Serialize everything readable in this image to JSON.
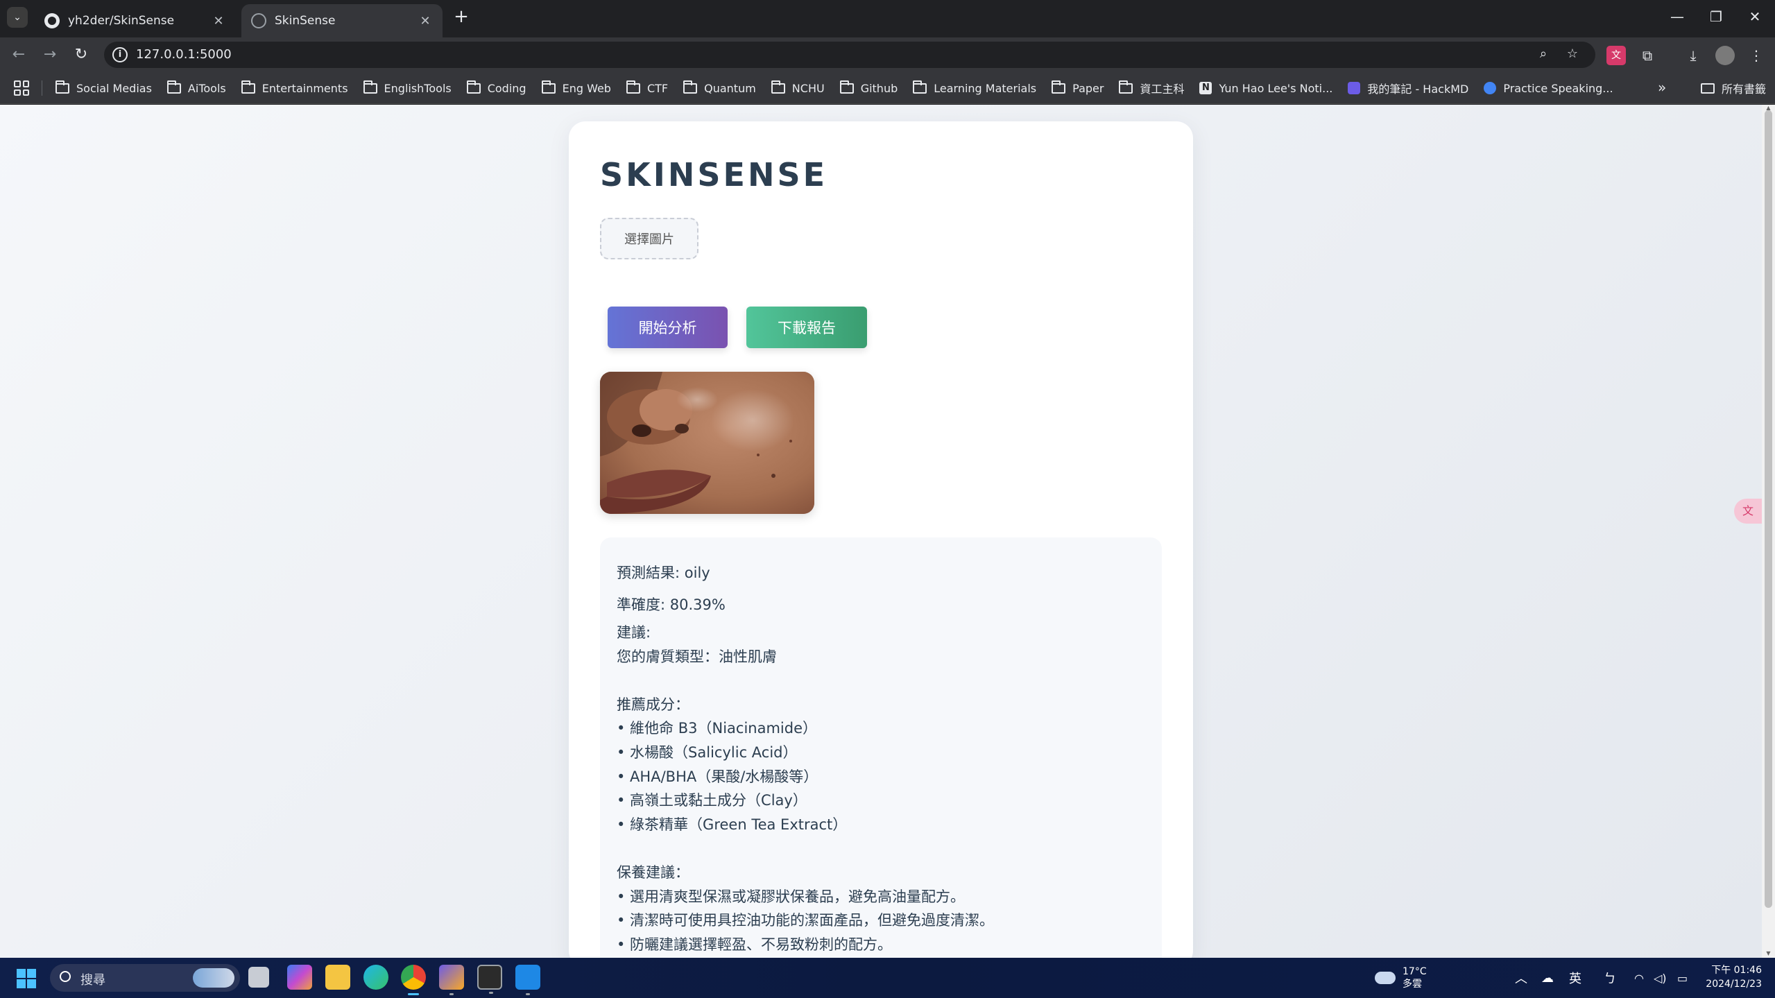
{
  "browser": {
    "tabs": [
      {
        "title": "yh2der/SkinSense",
        "icon": "github-icon"
      },
      {
        "title": "SkinSense",
        "icon": "globe-icon"
      }
    ],
    "address": "127.0.0.1:5000",
    "bookmarks": [
      {
        "label": "Social Medias",
        "icon": "folder-icon"
      },
      {
        "label": "AiTools",
        "icon": "folder-icon"
      },
      {
        "label": "Entertainments",
        "icon": "folder-icon"
      },
      {
        "label": "EnglishTools",
        "icon": "folder-icon"
      },
      {
        "label": "Coding",
        "icon": "folder-icon"
      },
      {
        "label": "Eng Web",
        "icon": "folder-icon"
      },
      {
        "label": "CTF",
        "icon": "folder-icon"
      },
      {
        "label": "Quantum",
        "icon": "folder-icon"
      },
      {
        "label": "NCHU",
        "icon": "folder-icon"
      },
      {
        "label": "Github",
        "icon": "folder-icon"
      },
      {
        "label": "Learning Materials",
        "icon": "folder-icon"
      },
      {
        "label": "Paper",
        "icon": "folder-icon"
      },
      {
        "label": "資工主科",
        "icon": "folder-icon"
      },
      {
        "label": "Yun Hao Lee's Noti...",
        "icon": "notion-icon"
      },
      {
        "label": "我的筆記 - HackMD",
        "icon": "hackmd-icon"
      },
      {
        "label": "Practice Speaking...",
        "icon": "practice-icon"
      }
    ],
    "all_bookmarks": "所有書籤"
  },
  "app": {
    "title": "SKINSENSE",
    "file_button": "選擇圖片",
    "analyze_button": "開始分析",
    "download_button": "下載報告",
    "result": {
      "prediction_label": "預測結果:",
      "prediction_value": "oily",
      "confidence_label": "準確度:",
      "confidence_value": "80.39%",
      "advice_label": "建議:",
      "skin_type": "您的膚質類型：油性肌膚",
      "ingredients_title": "推薦成分：",
      "ingredients": [
        "• 維他命 B3（Niacinamide）",
        "• 水楊酸（Salicylic Acid）",
        "• AHA/BHA（果酸/水楊酸等）",
        "• 高嶺土或黏土成分（Clay）",
        "• 綠茶精華（Green Tea Extract）"
      ],
      "care_title": "保養建議：",
      "care": [
        "• 選用清爽型保濕或凝膠狀保養品，避免高油量配方。",
        "• 清潔時可使用具控油功能的潔面產品，但避免過度清潔。",
        "• 防曬建議選擇輕盈、不易致粉刺的配方。"
      ]
    },
    "colors": {
      "title": "#2c3e50",
      "analyze_start": "#6474d6",
      "analyze_end": "#7a52b0",
      "download_start": "#52c59a",
      "download_end": "#3a9d70"
    }
  },
  "taskbar": {
    "search_placeholder": "搜尋",
    "weather_temp": "17°C",
    "weather_desc": "多雲",
    "ime": "英",
    "time": "下午 01:46",
    "date": "2024/12/23"
  }
}
